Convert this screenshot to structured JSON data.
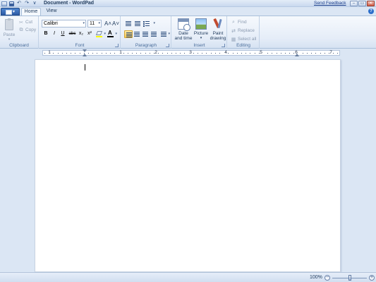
{
  "window": {
    "title": "Document - WordPad",
    "feedback_link": "Send Feedback"
  },
  "tabs": [
    {
      "label": "Home",
      "active": true
    },
    {
      "label": "View",
      "active": false
    }
  ],
  "ribbon": {
    "clipboard": {
      "label": "Clipboard",
      "paste": "Paste",
      "cut": "Cut",
      "copy": "Copy"
    },
    "font": {
      "label": "Font",
      "font_name": "Calibri",
      "font_size": "11",
      "bold": "B",
      "italic": "I",
      "underline": "U",
      "strikethrough": "abc",
      "subscript": "x₂",
      "superscript": "x²",
      "grow": "A˄",
      "shrink": "A˅",
      "color_letter": "A"
    },
    "paragraph": {
      "label": "Paragraph"
    },
    "insert": {
      "label": "Insert",
      "date_time": "Date and time",
      "picture": "Picture",
      "paint": "Paint drawing"
    },
    "editing": {
      "label": "Editing",
      "find": "Find",
      "replace": "Replace",
      "select_all": "Select all"
    }
  },
  "ruler": {
    "numbers": [
      "1",
      "1",
      "2",
      "3",
      "4",
      "5",
      "6",
      "7"
    ]
  },
  "status": {
    "zoom": "100%"
  },
  "colors": {
    "accent": "#2c5ba6",
    "highlight": "#ffff00",
    "font_color": "#000000"
  }
}
